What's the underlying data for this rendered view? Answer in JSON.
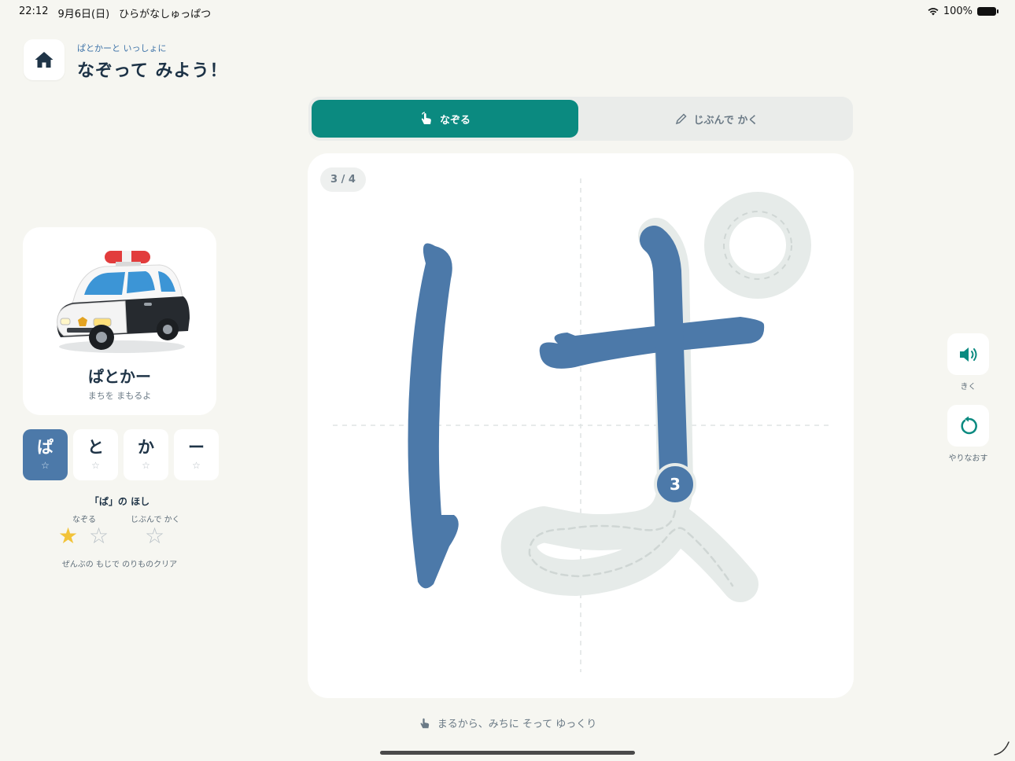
{
  "status_bar": {
    "time": "22:12",
    "date": "9月6日(日)",
    "app_name": "ひらがなしゅっぱつ",
    "battery": "100%"
  },
  "header": {
    "subtitle": "ぱとかーと いっしょに",
    "title": "なぞって みよう！",
    "home_icon": "home-icon"
  },
  "vehicle": {
    "name": "ぱとかー",
    "description": "まちを まもるよ"
  },
  "characters": [
    {
      "char": "ぱ",
      "star": "☆",
      "active": true
    },
    {
      "char": "と",
      "star": "☆",
      "active": false
    },
    {
      "char": "か",
      "star": "☆",
      "active": false
    },
    {
      "char": "ー",
      "star": "☆",
      "active": false
    }
  ],
  "stars": {
    "title": "「ぱ」の ほし",
    "trace_label": "なぞる",
    "free_label": "じぶんで かく",
    "note": "ぜんぶの もじで のりものクリア",
    "star_filled": "★",
    "star_empty": "☆",
    "trace_stars_earned": 1,
    "trace_stars_total": 2,
    "free_stars_earned": 0
  },
  "modes": {
    "trace": "なぞる",
    "free": "じぶんで かく",
    "selected": "trace"
  },
  "canvas": {
    "page": "3 / 4",
    "current_stroke": "3",
    "strokes_done": 2,
    "strokes_total": 4
  },
  "controls": {
    "listen_label": "きく",
    "retry_label": "やりなおす"
  },
  "hint": "まるから、みちに そって ゆっくり",
  "colors": {
    "accent": "#0b8a80",
    "stroke": "#4c79a9",
    "guide": "#e6ebe9",
    "star": "#f2c339"
  }
}
